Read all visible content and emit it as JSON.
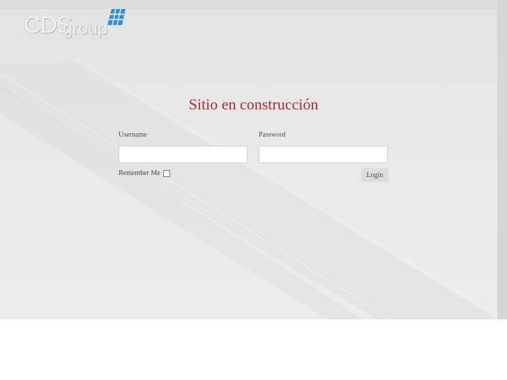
{
  "brand": {
    "logo_main": "CDS",
    "logo_secondary": "group",
    "tagline": "Consultoría Gerencial · Desarrollo de Soluciones",
    "accent_color": "#2f8fd6"
  },
  "page": {
    "title": "Sitio en construcción",
    "title_color": "#a8282e"
  },
  "login": {
    "username_label": "Username",
    "username_value": "",
    "password_label": "Password",
    "password_value": "",
    "remember_label": "Remember Me",
    "remember_checked": false,
    "submit_label": "Login"
  }
}
